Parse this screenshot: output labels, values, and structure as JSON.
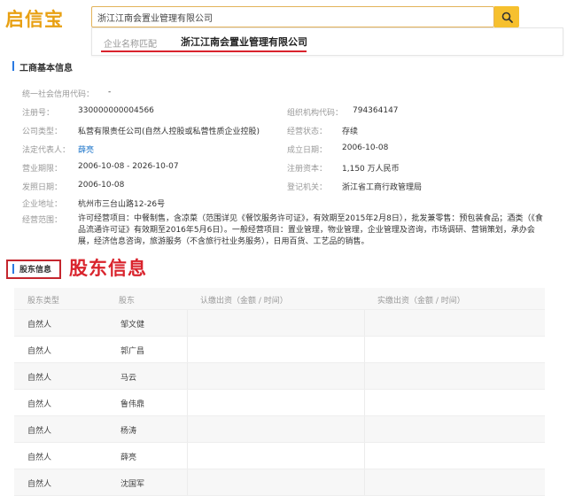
{
  "header": {
    "logo": "启信宝",
    "search_value": "浙江江南会置业管理有限公司"
  },
  "dropdown": {
    "label": "企业名称匹配",
    "value": "浙江江南会置业管理有限公司"
  },
  "basic_info": {
    "title": "工商基本信息",
    "left": [
      {
        "label": "统一社会信用代码：",
        "value": "-"
      },
      {
        "label": "注册号：",
        "value": "330000000004566"
      },
      {
        "label": "公司类型：",
        "value": "私营有限责任公司(自然人控股或私营性质企业控股)"
      },
      {
        "label": "法定代表人：",
        "value": "薛亮"
      },
      {
        "label": "营业期限：",
        "value": "2006-10-08 - 2026-10-07"
      },
      {
        "label": "发照日期：",
        "value": "2006-10-08"
      },
      {
        "label": "企业地址：",
        "value": "杭州市三台山路12-26号"
      }
    ],
    "right": [
      {
        "label": "组织机构代码：",
        "value": "794364147"
      },
      {
        "label": "经营状态：",
        "value": "存续"
      },
      {
        "label": "成立日期：",
        "value": "2006-10-08"
      },
      {
        "label": "注册资本：",
        "value": "1,150 万人民币"
      },
      {
        "label": "登记机关：",
        "value": "浙江省工商行政管理局"
      }
    ],
    "scope_label": "经营范围：",
    "scope_text": "许可经营项目：中餐制售，含凉菜（范围详见《餐饮服务许可证》，有效期至2015年2月8日），批发兼零售：预包装食品；酒类（《食品流通许可证》有效期至2016年5月6日）。一般经营项目：置业管理，物业管理，企业管理及咨询，市场调研、营销策划，承办会展，经济信息咨询，旅游服务（不含旅行社业务服务），日用百货、工艺品的销售。"
  },
  "shareholder": {
    "title": "股东信息",
    "annotation": "股东信息",
    "columns": [
      "股东类型",
      "股东",
      "认缴出资（金额 / 时间）",
      "实缴出资（金额 / 时间）"
    ],
    "rows": [
      {
        "type": "自然人",
        "name": "邹文健"
      },
      {
        "type": "自然人",
        "name": "郭广昌"
      },
      {
        "type": "自然人",
        "name": "马云"
      },
      {
        "type": "自然人",
        "name": "鲁伟鼎"
      },
      {
        "type": "自然人",
        "name": "杨涛"
      },
      {
        "type": "自然人",
        "name": "薛亮"
      },
      {
        "type": "自然人",
        "name": "沈国军"
      }
    ]
  },
  "colors": {
    "accent": "#f6c02e",
    "logo": "#e8a012",
    "annotation_red": "#d9232c",
    "link": "#1a73c9",
    "section_bar": "#2a7ae2"
  }
}
